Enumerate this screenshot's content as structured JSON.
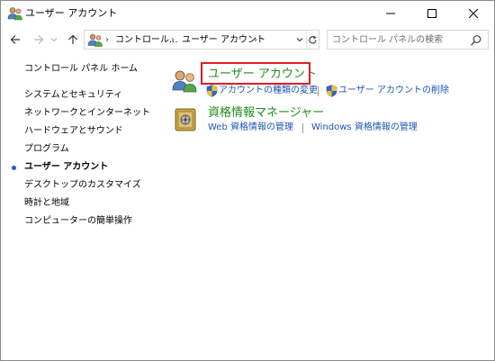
{
  "window": {
    "title": "ユーザー アカウント",
    "controls": {
      "minimize": "minimize-icon",
      "maximize": "maximize-icon",
      "close": "close-icon"
    }
  },
  "nav": {
    "breadcrumb": [
      {
        "label": "コントロール..."
      },
      {
        "label": "ユーザー アカウント"
      }
    ],
    "search_placeholder": "コントロール パネルの検索"
  },
  "sidebar": {
    "items": [
      {
        "label": "コントロール パネル ホーム",
        "current": false
      },
      {
        "label": "システムとセキュリティ",
        "current": false
      },
      {
        "label": "ネットワークとインターネット",
        "current": false
      },
      {
        "label": "ハードウェアとサウンド",
        "current": false
      },
      {
        "label": "プログラム",
        "current": false
      },
      {
        "label": "ユーザー アカウント",
        "current": true
      },
      {
        "label": "デスクトップのカスタマイズ",
        "current": false
      },
      {
        "label": "時計と地域",
        "current": false
      },
      {
        "label": "コンピューターの簡単操作",
        "current": false
      }
    ]
  },
  "main": {
    "categories": [
      {
        "title": "ユーザー アカウント",
        "icon": "user-accounts-icon",
        "highlighted": true,
        "links": [
          {
            "label": "アカウントの種類の変更",
            "shield": true
          },
          {
            "label": "ユーザー アカウントの削除",
            "shield": true
          }
        ]
      },
      {
        "title": "資格情報マネージャー",
        "icon": "credential-manager-icon",
        "highlighted": false,
        "links": [
          {
            "label": "Web 資格情報の管理",
            "shield": false
          },
          {
            "label": "Windows 資格情報の管理",
            "shield": false
          }
        ]
      }
    ]
  },
  "colors": {
    "category_title": "#1e8c1e",
    "link": "#1a55b8",
    "highlight_border": "#e01b24",
    "current_bullet": "#1c5ccc"
  }
}
